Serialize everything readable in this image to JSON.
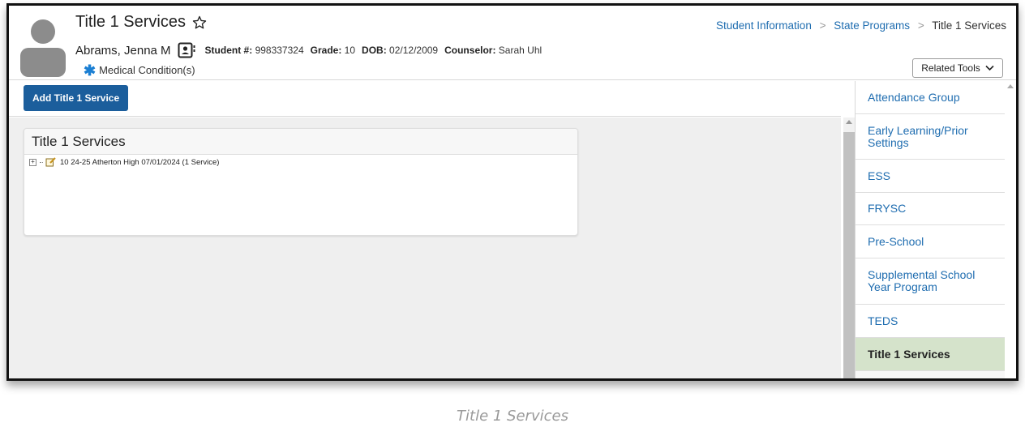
{
  "header": {
    "page_title": "Title 1 Services",
    "student_name": "Abrams, Jenna M",
    "fields": [
      {
        "label": "Student #:",
        "value": "998337324"
      },
      {
        "label": "Grade:",
        "value": "10"
      },
      {
        "label": "DOB:",
        "value": "02/12/2009"
      },
      {
        "label": "Counselor:",
        "value": "Sarah Uhl"
      }
    ],
    "medical": "Medical Condition(s)",
    "related_tools": "Related Tools"
  },
  "breadcrumb": {
    "items": [
      "Student Information",
      "State Programs"
    ],
    "current": "Title 1 Services",
    "separator": ">"
  },
  "toolbar": {
    "add_label": "Add Title 1 Service"
  },
  "panel": {
    "title": "Title 1 Services",
    "tree": [
      {
        "label": "10 24-25 Atherton High 07/01/2024 (1 Service)",
        "expander": "+"
      }
    ]
  },
  "sidebar": {
    "items": [
      {
        "label": "Attendance Group",
        "active": false
      },
      {
        "label": "Early Learning/Prior Settings",
        "active": false
      },
      {
        "label": "ESS",
        "active": false
      },
      {
        "label": "FRYSC",
        "active": false
      },
      {
        "label": "Pre-School",
        "active": false
      },
      {
        "label": "Supplemental School Year Program",
        "active": false
      },
      {
        "label": "TEDS",
        "active": false
      },
      {
        "label": "Title 1 Services",
        "active": true
      }
    ]
  },
  "caption": "Title 1 Services",
  "colors": {
    "accent": "#1b5e9c",
    "link": "#1f6db0",
    "active_item": "#d5e3cb"
  }
}
